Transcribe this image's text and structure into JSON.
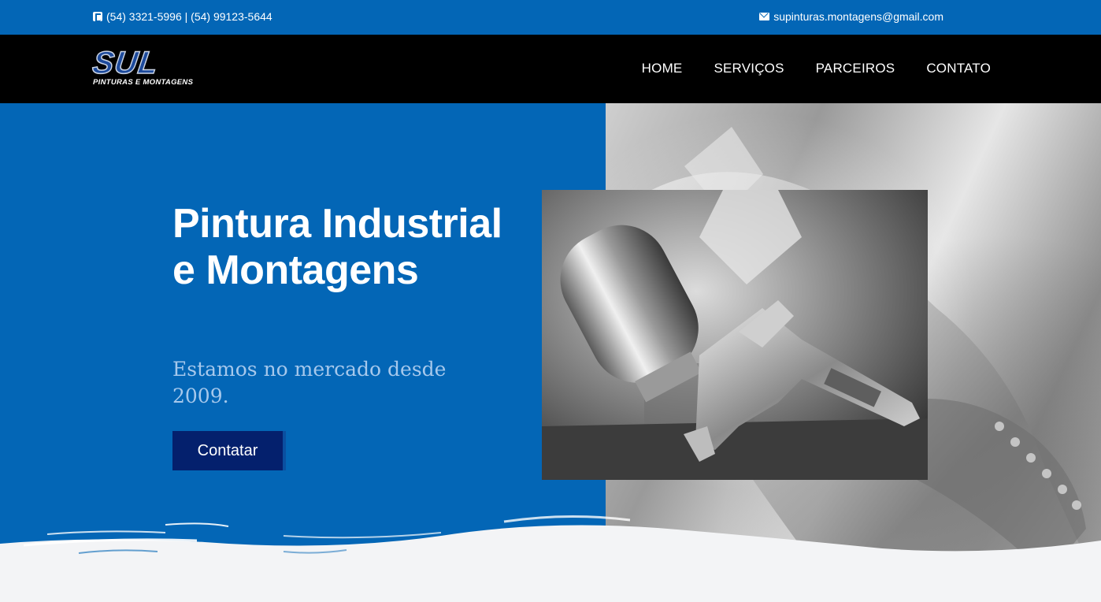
{
  "topbar": {
    "phone": "(54) 3321-5996 | (54) 99123-5644",
    "email": "supinturas.montagens@gmail.com",
    "phone_icon": "phone-square-icon",
    "email_icon": "envelope-icon"
  },
  "logo": {
    "mark": "SUL",
    "subtitle": "PINTURAS E MONTAGENS"
  },
  "nav": {
    "items": [
      {
        "label": "HOME"
      },
      {
        "label": "SERVIÇOS"
      },
      {
        "label": "PARCEIROS"
      },
      {
        "label": "CONTATO"
      }
    ]
  },
  "hero": {
    "title": "Pintura Industrial e Montagens",
    "subtitle": "Estamos no mercado desde 2009.",
    "cta_label": "Contatar"
  },
  "colors": {
    "primary_blue": "#0366b6",
    "dark_blue": "#04206d",
    "nav_bg": "#000000",
    "subtitle_blue": "#a6c8ec",
    "page_bg": "#f3f4f6"
  }
}
